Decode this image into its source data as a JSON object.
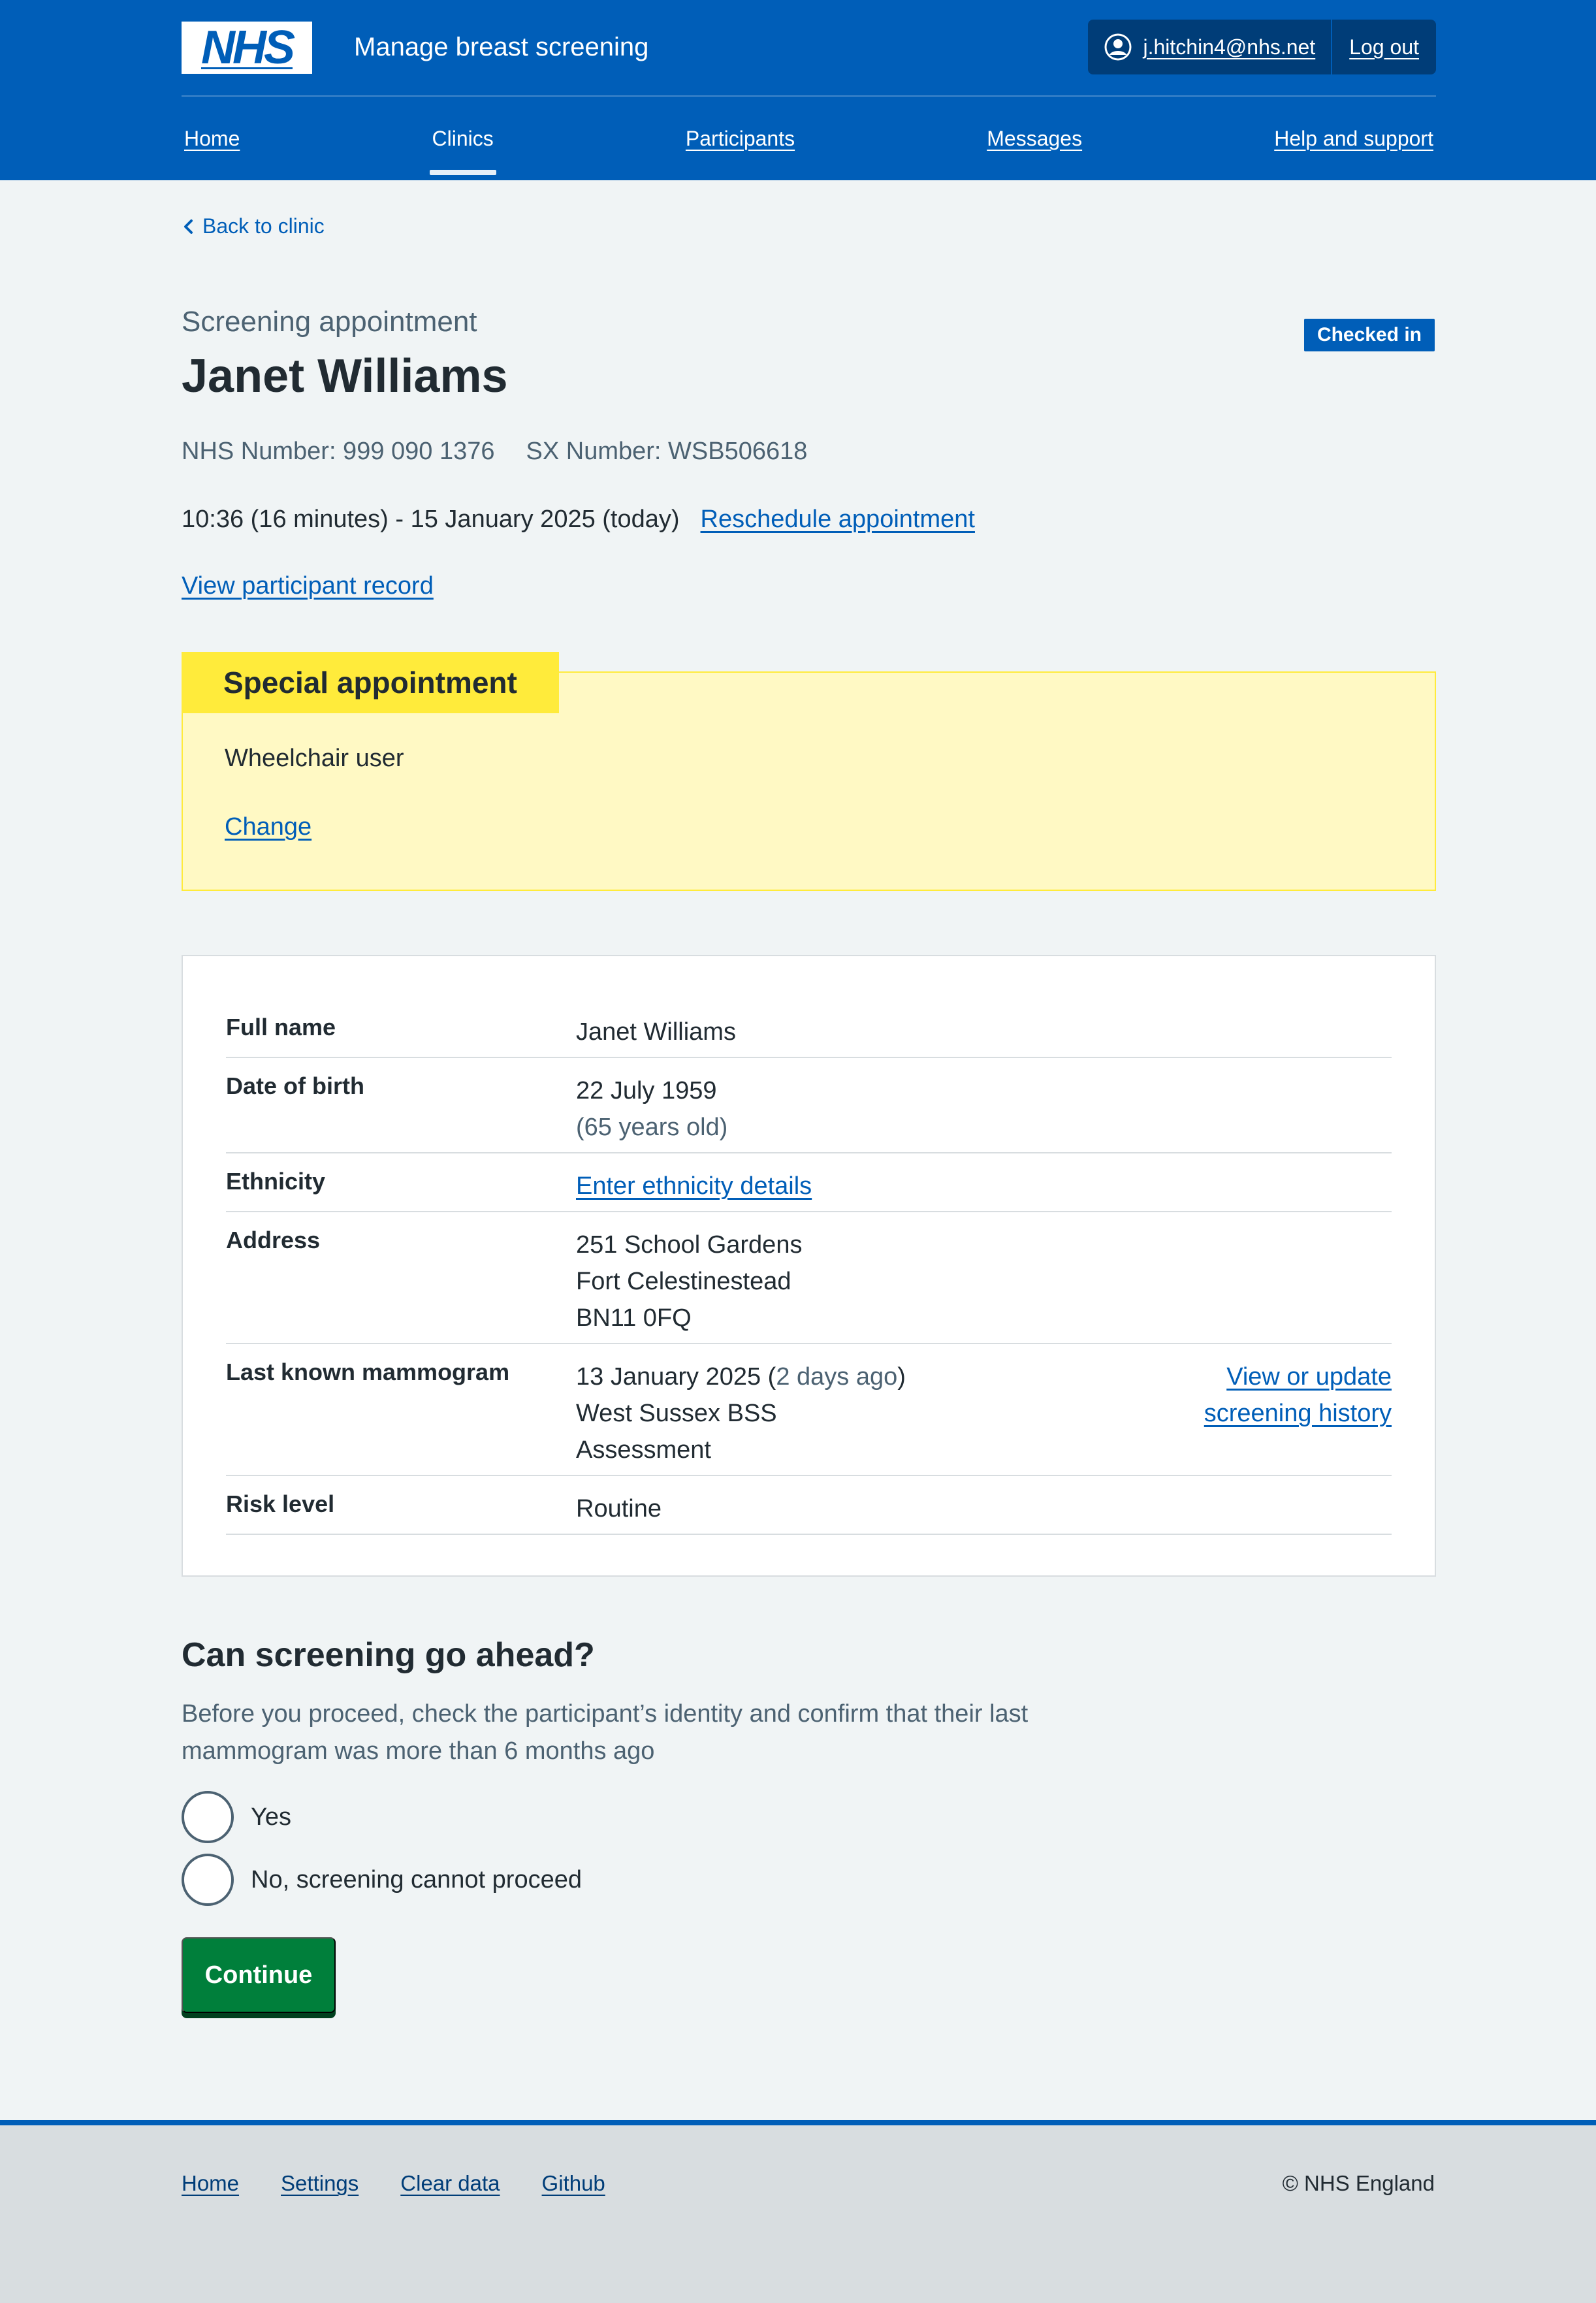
{
  "header": {
    "logo_text": "NHS",
    "service_name": "Manage breast screening",
    "user_email": "j.hitchin4@nhs.net",
    "logout_label": "Log out"
  },
  "nav": [
    {
      "label": "Home",
      "current": false
    },
    {
      "label": "Clinics",
      "current": true
    },
    {
      "label": "Participants",
      "current": false
    },
    {
      "label": "Messages",
      "current": false
    },
    {
      "label": "Help and support",
      "current": false
    }
  ],
  "back_link": "Back to clinic",
  "appointment": {
    "caption": "Screening appointment",
    "name": "Janet Williams",
    "status_tag": "Checked in",
    "nhs_number": "NHS Number: 999 090 1376",
    "sx_number": "SX Number: WSB506618",
    "time": "10:36 (16 minutes) - 15 January 2025 (today)",
    "reschedule_label": "Reschedule appointment",
    "view_record_label": "View participant record"
  },
  "special": {
    "heading": "Special appointment",
    "body": "Wheelchair user",
    "change_label": "Change"
  },
  "summary": {
    "full_name_key": "Full name",
    "full_name": "Janet Williams",
    "dob_key": "Date of birth",
    "dob": "22 July 1959",
    "age": "(65 years old)",
    "ethnicity_key": "Ethnicity",
    "ethnicity_link": "Enter ethnicity details",
    "address_key": "Address",
    "address_line1": "251 School Gardens",
    "address_line2": "Fort Celestinestead",
    "address_line3": "BN11 0FQ",
    "mammogram_key": "Last known mammogram",
    "mammogram_date": "13 January 2025 (",
    "mammogram_ago": "2 days ago",
    "mammogram_close": ")",
    "mammogram_place": "West Sussex BSS",
    "mammogram_type": "Assessment",
    "mammogram_action_line1": "View or update",
    "mammogram_action_line2": "screening history",
    "risk_key": "Risk level",
    "risk": "Routine"
  },
  "question": {
    "title": "Can screening go ahead?",
    "hint": "Before you proceed, check the participant’s identity and confirm that their last mammogram was more than 6 months ago",
    "option_yes": "Yes",
    "option_no": "No, screening cannot proceed",
    "continue_label": "Continue"
  },
  "footer": {
    "links": [
      "Home",
      "Settings",
      "Clear data",
      "Github"
    ],
    "copyright": "© NHS England"
  },
  "colors": {
    "nhs_blue": "#005eb8",
    "dark_blue": "#003d78",
    "green_button": "#007f3b",
    "warning_yellow": "#ffeb3b",
    "warning_bg": "#fff9c4",
    "page_bg": "#f0f4f5"
  }
}
